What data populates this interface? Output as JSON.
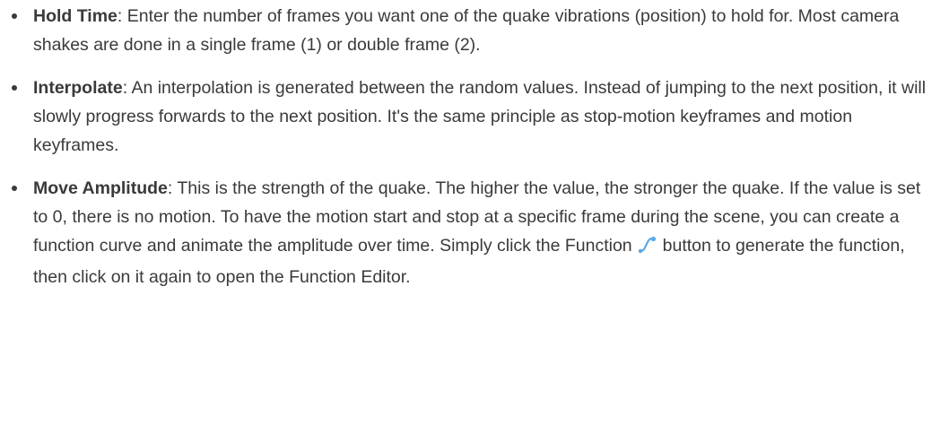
{
  "items": [
    {
      "term": "Hold Time",
      "text": ": Enter the number of frames you want one of the quake vibrations (position) to hold for. Most camera shakes are done in a single frame (1) or double frame (2)."
    },
    {
      "term": "Interpolate",
      "text": ": An interpolation is generated between the random values. Instead of jumping to the next position, it will slowly progress forwards to the next position. It's the same principle as stop-motion keyframes and motion keyframes."
    },
    {
      "term": "Move Amplitude",
      "text_before": ": This is the strength of the quake. The higher the value, the stronger the quake. If the value is set to 0, there is no motion. To have the motion start and stop at a specific frame during the scene, you can create a function curve and animate the amplitude over time. Simply click the Function",
      "icon": "function-curve-icon",
      "text_after": "button to generate the function, then click on it again to open the Function Editor."
    }
  ],
  "colors": {
    "text": "#3a3a3a",
    "icon": "#5aa9e6"
  }
}
